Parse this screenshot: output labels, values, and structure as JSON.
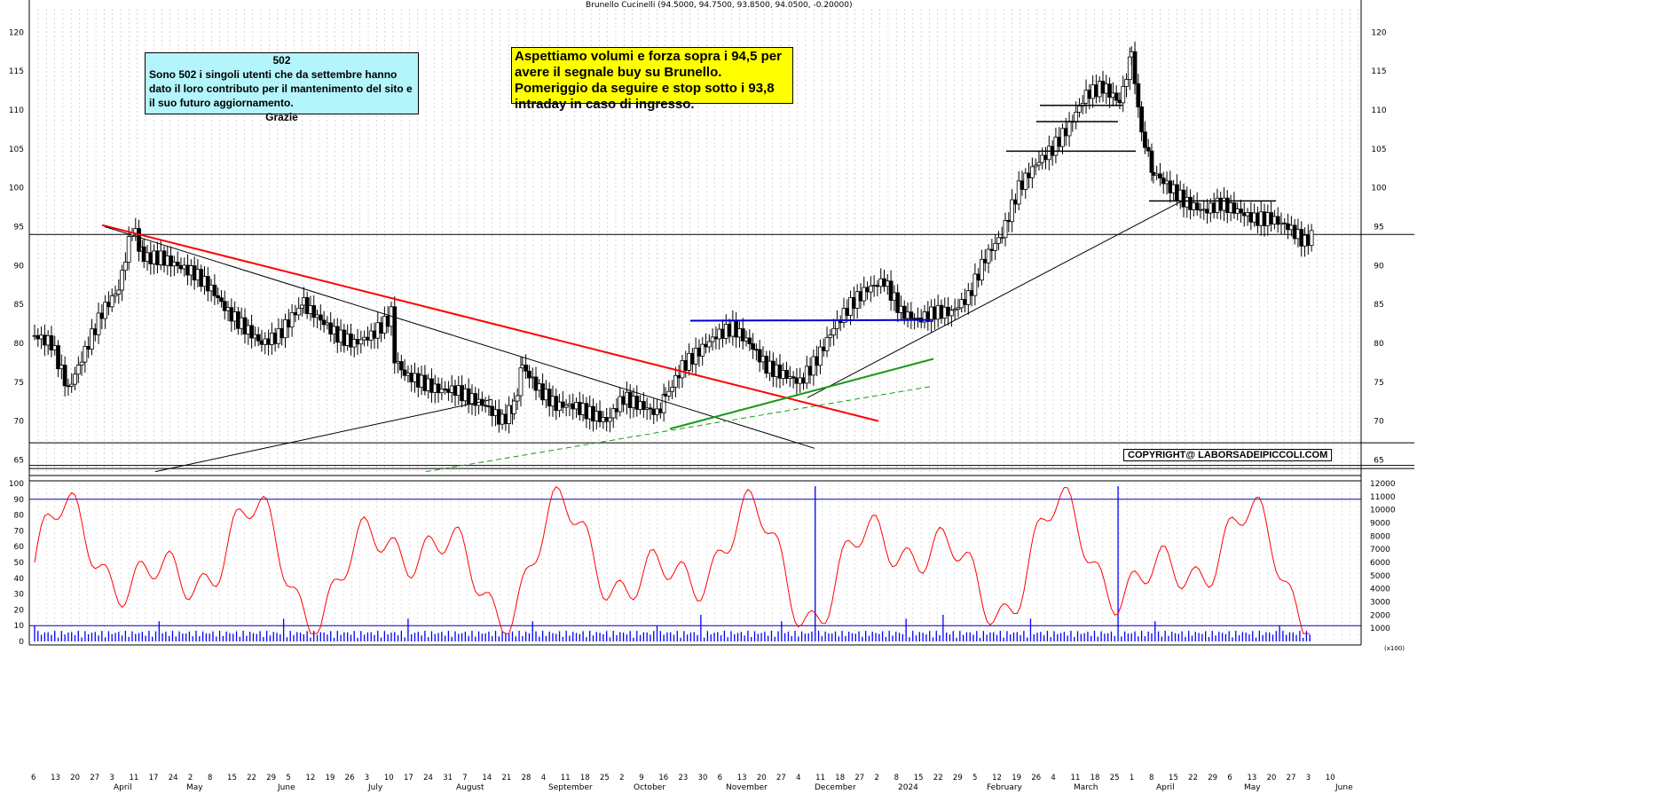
{
  "chart_data": [
    {
      "type": "candlestick",
      "title": "Brunello Cucinelli (94.5000, 94.7500, 93.8500, 94.0500, -0.20000)",
      "ylim": [
        63,
        123
      ],
      "yticks": [
        65,
        70,
        75,
        80,
        85,
        90,
        95,
        100,
        105,
        110,
        115,
        120
      ],
      "months": [
        "April",
        "May",
        "June",
        "July",
        "August",
        "September",
        "October",
        "November",
        "December",
        "2024",
        "February",
        "March",
        "April",
        "May",
        "June"
      ],
      "day_ticks": [
        "6",
        "13",
        "20",
        "27",
        "3",
        "11",
        "17",
        "24",
        "2",
        "8",
        "15",
        "22",
        "29",
        "5",
        "12",
        "19",
        "26",
        "3",
        "10",
        "17",
        "24",
        "31",
        "7",
        "14",
        "21",
        "28",
        "4",
        "11",
        "18",
        "25",
        "2",
        "9",
        "16",
        "23",
        "30",
        "6",
        "13",
        "20",
        "27",
        "4",
        "11",
        "18",
        "27",
        "2",
        "8",
        "15",
        "22",
        "29",
        "5",
        "12",
        "19",
        "26",
        "4",
        "11",
        "18",
        "25",
        "1",
        "8",
        "15",
        "22",
        "29",
        "6",
        "13",
        "20",
        "27",
        "3",
        "10"
      ],
      "price_path": [
        [
          0,
          81
        ],
        [
          10,
          80
        ],
        [
          20,
          74
        ],
        [
          30,
          79
        ],
        [
          40,
          84
        ],
        [
          50,
          87
        ],
        [
          58,
          95
        ],
        [
          65,
          91
        ],
        [
          75,
          91
        ],
        [
          85,
          90
        ],
        [
          95,
          89
        ],
        [
          105,
          87
        ],
        [
          115,
          84
        ],
        [
          125,
          82
        ],
        [
          135,
          80
        ],
        [
          145,
          81
        ],
        [
          155,
          84
        ],
        [
          160,
          85
        ],
        [
          170,
          83
        ],
        [
          180,
          81
        ],
        [
          190,
          80
        ],
        [
          200,
          81
        ],
        [
          210,
          83
        ],
        [
          212,
          84
        ],
        [
          214,
          78
        ],
        [
          220,
          76
        ],
        [
          230,
          75
        ],
        [
          240,
          74
        ],
        [
          250,
          74
        ],
        [
          258,
          73
        ],
        [
          268,
          72
        ],
        [
          278,
          70
        ],
        [
          285,
          72
        ],
        [
          290,
          77
        ],
        [
          300,
          74
        ],
        [
          310,
          72
        ],
        [
          320,
          72
        ],
        [
          330,
          71
        ],
        [
          340,
          70
        ],
        [
          350,
          73
        ],
        [
          360,
          72
        ],
        [
          370,
          71
        ],
        [
          375,
          73
        ],
        [
          385,
          77
        ],
        [
          395,
          79
        ],
        [
          405,
          81
        ],
        [
          415,
          82
        ],
        [
          425,
          80
        ],
        [
          435,
          77
        ],
        [
          445,
          76
        ],
        [
          455,
          75
        ],
        [
          465,
          78
        ],
        [
          475,
          82
        ],
        [
          485,
          85
        ],
        [
          495,
          87
        ],
        [
          505,
          88
        ],
        [
          515,
          84
        ],
        [
          525,
          83
        ],
        [
          535,
          84
        ],
        [
          545,
          84
        ],
        [
          555,
          86
        ],
        [
          565,
          91
        ],
        [
          575,
          94
        ],
        [
          585,
          100
        ],
        [
          595,
          103
        ],
        [
          605,
          105
        ],
        [
          615,
          108
        ],
        [
          625,
          112
        ],
        [
          635,
          113
        ],
        [
          645,
          111
        ],
        [
          652,
          117
        ],
        [
          658,
          107
        ],
        [
          665,
          102
        ],
        [
          675,
          100
        ],
        [
          685,
          98
        ],
        [
          695,
          97
        ],
        [
          705,
          98
        ],
        [
          715,
          97
        ],
        [
          725,
          96
        ],
        [
          735,
          96
        ],
        [
          745,
          95
        ],
        [
          755,
          93
        ],
        [
          760,
          94
        ]
      ],
      "oscillator": {
        "ylim": [
          0,
          100
        ],
        "yticks": [
          0,
          10,
          20,
          30,
          40,
          50,
          60,
          70,
          80,
          90,
          100
        ],
        "levels": [
          90,
          10
        ]
      },
      "volume": {
        "ylim": [
          0,
          12000
        ],
        "yticks": [
          1000,
          2000,
          3000,
          4000,
          5000,
          6000,
          7000,
          8000,
          9000,
          10000,
          11000,
          12000
        ],
        "right_label": "(x100)"
      }
    }
  ],
  "annotations": {
    "counter_title": "502",
    "counter_body": "Sono 502 i singoli utenti che da settembre hanno dato il loro contributo per il mantenimento del sito e il suo futuro aggiornamento.",
    "counter_thanks": "Grazie",
    "signal": "Aspettiamo volumi e forza sopra i 94,5 per avere il segnale buy su Brunello. Pomeriggio da seguire e stop sotto i 93,8 intraday in caso di ingresso.",
    "copyright": "COPYRIGHT@ LABORSADEIPICCOLI.COM"
  },
  "colors": {
    "candle": "#000000",
    "red_trend": "#ff0000",
    "green_trend": "#1a9a1a",
    "blue_level": "#0000cc",
    "oscillator": "#ff0000",
    "volume": "#0000ff",
    "cyan_box": "#b3f5fa",
    "yellow_box": "#ffff00"
  }
}
